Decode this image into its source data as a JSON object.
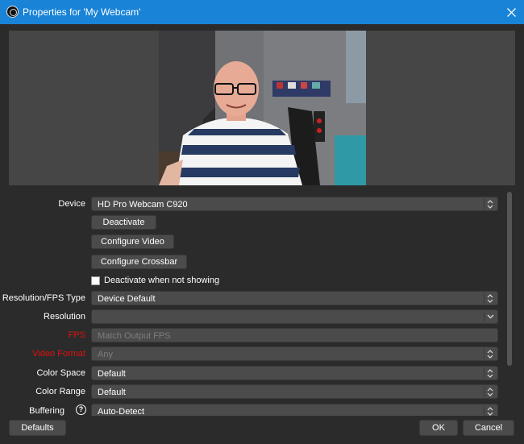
{
  "window": {
    "title": "Properties for 'My Webcam'"
  },
  "colors": {
    "titlebar": "#1883d7",
    "background": "#2b2b2b",
    "field": "#4b4b4b",
    "error_label": "#e01010"
  },
  "device": {
    "label": "Device",
    "value": "HD Pro Webcam C920"
  },
  "buttons": {
    "deactivate": "Deactivate",
    "configure_video": "Configure Video",
    "configure_crossbar": "Configure Crossbar"
  },
  "deactivate_when_not_showing": {
    "label": "Deactivate when not showing",
    "checked": false
  },
  "resolution_fps_type": {
    "label": "Resolution/FPS Type",
    "value": "Device Default"
  },
  "resolution": {
    "label": "Resolution",
    "value": ""
  },
  "fps": {
    "label": "FPS",
    "value": "Match Output FPS"
  },
  "video_format": {
    "label": "Video Format",
    "value": "Any"
  },
  "color_space": {
    "label": "Color Space",
    "value": "Default"
  },
  "color_range": {
    "label": "Color Range",
    "value": "Default"
  },
  "buffering": {
    "label": "Buffering",
    "value": "Auto-Detect",
    "help": "?"
  },
  "footer": {
    "defaults": "Defaults",
    "ok": "OK",
    "cancel": "Cancel"
  }
}
